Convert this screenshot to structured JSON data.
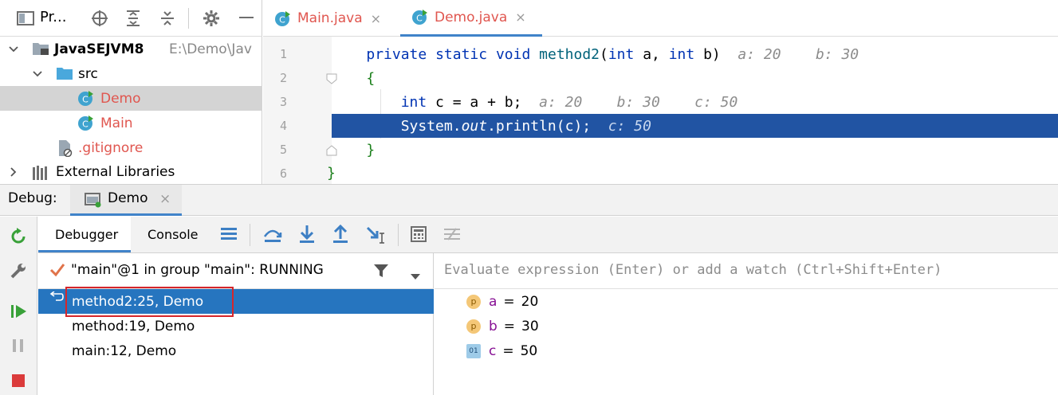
{
  "project_panel": {
    "title": "Pr...",
    "tree": [
      {
        "label": "JavaSEJVM8",
        "path": "E:\\Demo\\Jav"
      },
      {
        "label": "src"
      },
      {
        "label": "Demo"
      },
      {
        "label": "Main"
      },
      {
        "label": ".gitignore"
      },
      {
        "label": "External Libraries"
      }
    ]
  },
  "editor": {
    "tabs": [
      {
        "label": "Main.java",
        "close": "×"
      },
      {
        "label": "Demo.java",
        "close": "×"
      }
    ],
    "lines": [
      {
        "num": "1",
        "code": "    private static void method2(int a, int b)",
        "hint": "  a: 20    b: 30"
      },
      {
        "num": "2",
        "code": "    {",
        "hint": ""
      },
      {
        "num": "3",
        "code": "        int c = a + b;",
        "hint": "  a: 20    b: 30    c: 50"
      },
      {
        "num": "4",
        "code": "        System.out.println(c);",
        "hint": "  c: 50"
      },
      {
        "num": "5",
        "code": "    }",
        "hint": ""
      },
      {
        "num": "6",
        "code": "}",
        "hint": ""
      }
    ]
  },
  "debug": {
    "label": "Debug:",
    "tab_label": "Demo",
    "tab_close": "×",
    "toolbar": {
      "debugger_tab": "Debugger",
      "console_tab": "Console"
    },
    "thread": "\"main\"@1 in group \"main\": RUNNING",
    "evaluate_placeholder": "Evaluate expression (Enter) or add a watch (Ctrl+Shift+Enter)",
    "frames": [
      {
        "label": "method2:25, Demo"
      },
      {
        "label": "method:19, Demo"
      },
      {
        "label": "main:12, Demo"
      }
    ],
    "variables": [
      {
        "badge": "p",
        "name": "a",
        "eq": "=",
        "value": "20"
      },
      {
        "badge": "p",
        "name": "b",
        "eq": "=",
        "value": "30"
      },
      {
        "badge": "01",
        "name": "c",
        "eq": "=",
        "value": "50"
      }
    ]
  },
  "colors": {
    "selection_blue": "#2675bf",
    "current_line": "#2154a3",
    "highlight_box": "#d6262b",
    "file_name_red": "#e0564f"
  }
}
